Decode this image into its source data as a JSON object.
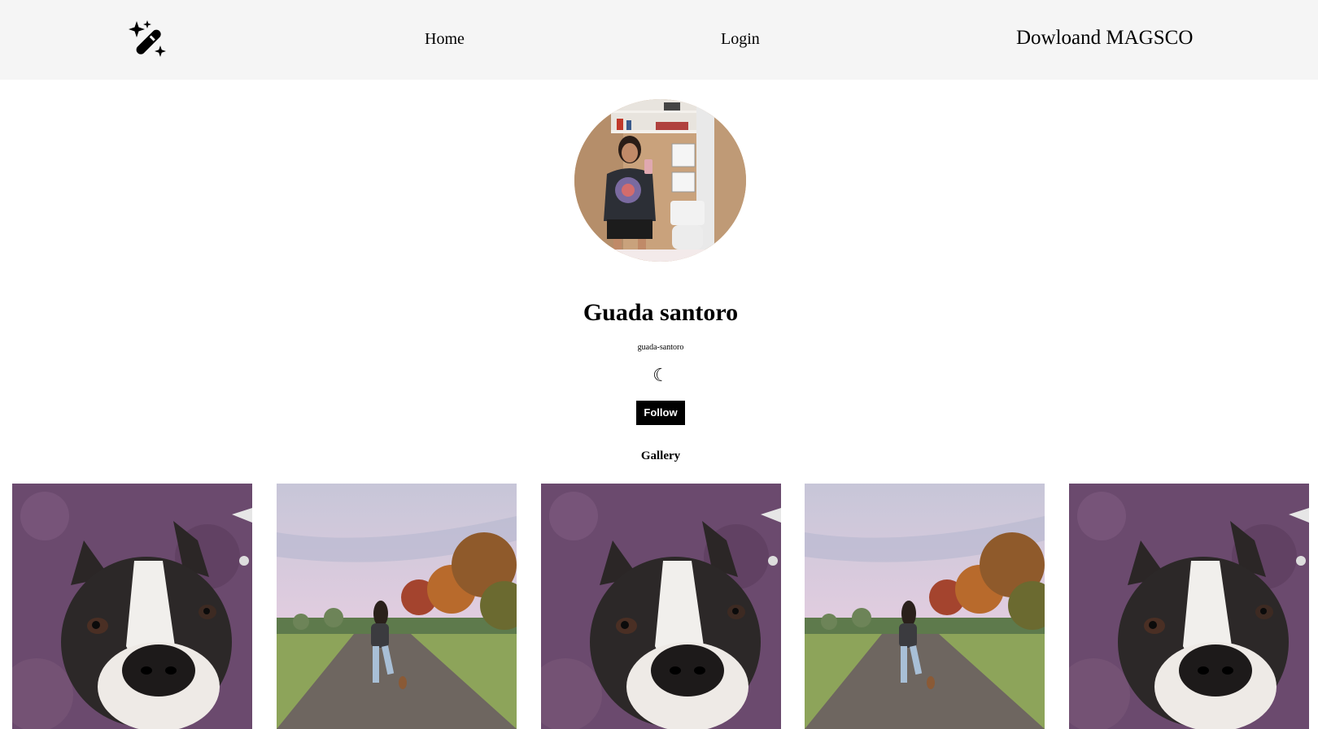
{
  "nav": {
    "logo_icon": "magic-wand-icon",
    "home_label": "Home",
    "login_label": "Login",
    "download_label": "Dowloand MAGSCO"
  },
  "profile": {
    "name": "Guada santoro",
    "handle": "guada-santoro",
    "theme_icon": "☾",
    "follow_label": "Follow"
  },
  "gallery": {
    "title": "Gallery",
    "items": [
      {
        "subject": "boston-terrier-dog"
      },
      {
        "subject": "person-walking-on-road"
      },
      {
        "subject": "boston-terrier-dog"
      },
      {
        "subject": "person-walking-on-road"
      },
      {
        "subject": "boston-terrier-dog"
      }
    ]
  },
  "colors": {
    "navbar_bg": "#f5f5f5",
    "button_bg": "#000000",
    "button_text": "#ffffff"
  }
}
